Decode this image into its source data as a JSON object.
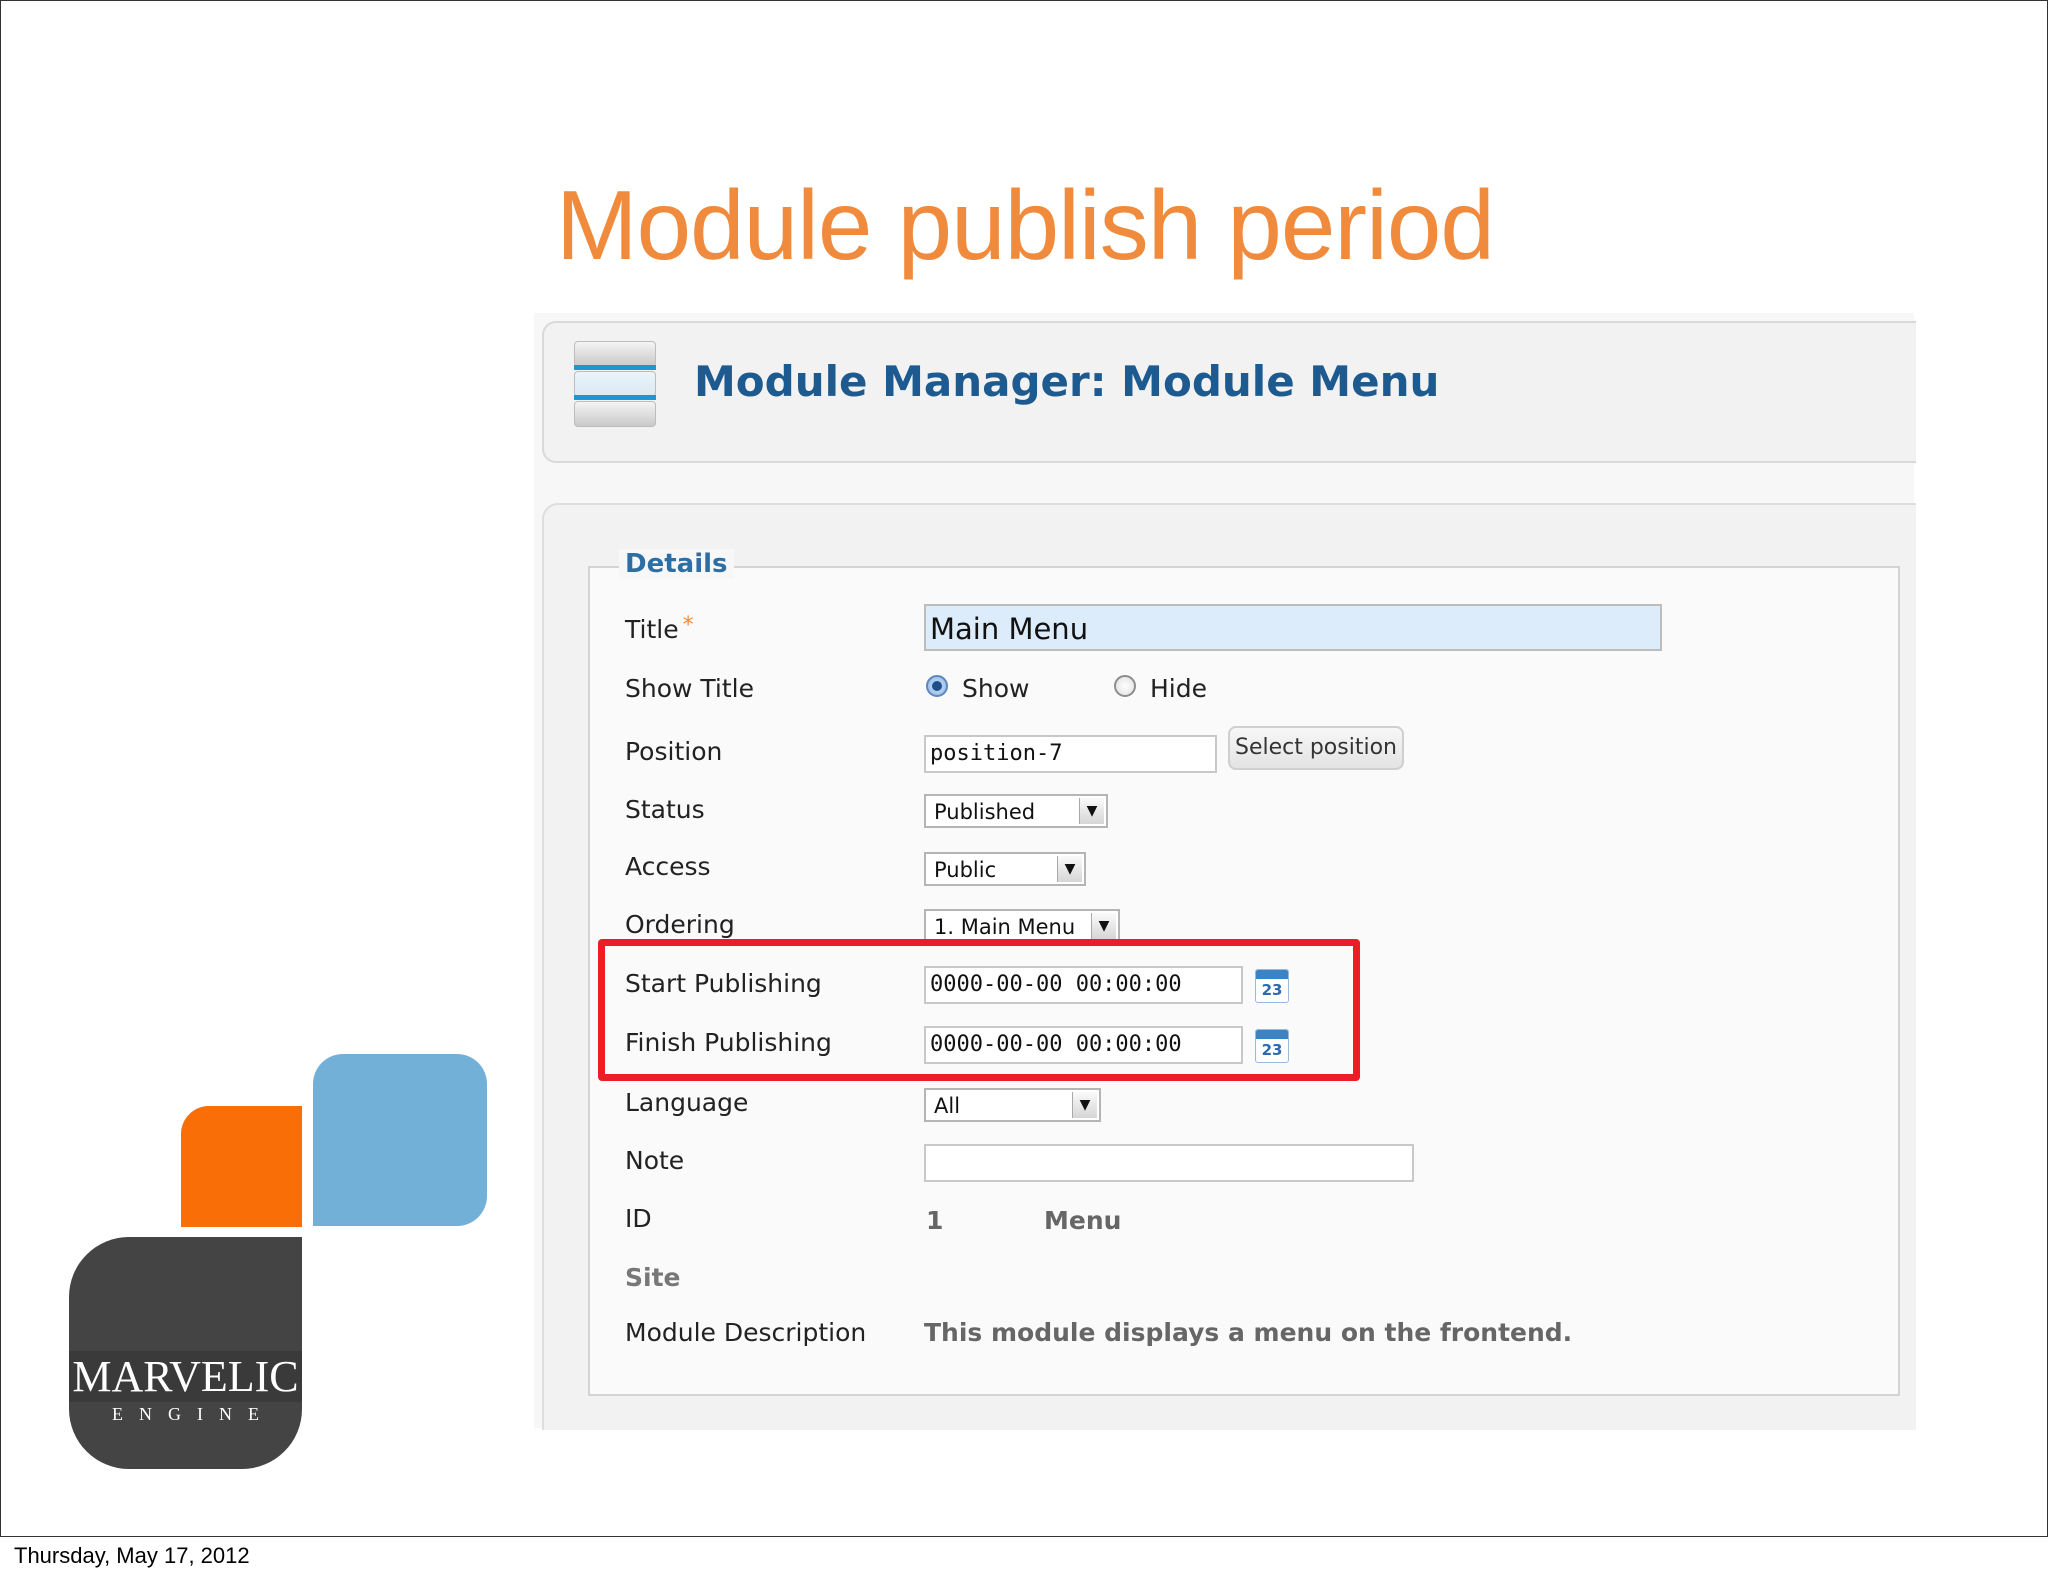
{
  "slide": {
    "title": "Module publish period",
    "footer_date": "Thursday, May 17, 2012"
  },
  "header": {
    "title": "Module Manager: Module Menu",
    "icon": "menu-module-icon"
  },
  "form": {
    "legend": "Details",
    "fields": {
      "title": {
        "label": "Title",
        "required_mark": "*",
        "value": "Main Menu"
      },
      "show_title": {
        "label": "Show Title",
        "options": [
          "Show",
          "Hide"
        ],
        "selected": "Show"
      },
      "position": {
        "label": "Position",
        "value": "position-7",
        "button": "Select position"
      },
      "status": {
        "label": "Status",
        "value": "Published"
      },
      "access": {
        "label": "Access",
        "value": "Public"
      },
      "ordering": {
        "label": "Ordering",
        "value": "1. Main Menu"
      },
      "start_publishing": {
        "label": "Start Publishing",
        "value": "0000-00-00 00:00:00",
        "calendar_day": "23"
      },
      "finish_publishing": {
        "label": "Finish Publishing",
        "value": "0000-00-00 00:00:00",
        "calendar_day": "23"
      },
      "language": {
        "label": "Language",
        "value": "All"
      },
      "note": {
        "label": "Note",
        "value": ""
      },
      "id": {
        "label": "ID",
        "value": "1",
        "type": "Menu"
      },
      "site": {
        "label": "Site"
      },
      "description": {
        "label": "Module Description",
        "value": "This module displays a menu on the frontend."
      }
    }
  },
  "logo": {
    "word": "MARVELIC",
    "sub": "ENGINE",
    "colors": {
      "orange": "#f96e06",
      "blue": "#73b0d8",
      "dark": "#444444"
    }
  },
  "colors": {
    "title": "#f08a3c",
    "header": "#1c5a8f",
    "highlight": "#ee1c24"
  }
}
